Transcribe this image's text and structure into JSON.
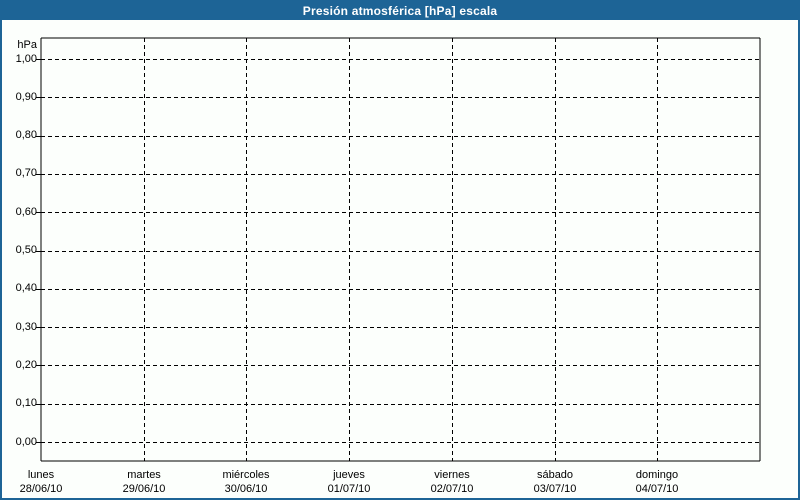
{
  "window": {
    "title": "Presión atmosférica [hPa] escala",
    "colors": {
      "title_bar": "#1d6496",
      "border": "#1d6496",
      "background": "#fcfffc",
      "grid": "#000000",
      "text": "#000000",
      "title_text": "#ffffff"
    }
  },
  "chart_data": {
    "type": "line",
    "title": "Presión atmosférica [hPa] escala",
    "ylabel": "hPa",
    "xlabel": "",
    "ylim": [
      0.0,
      1.0
    ],
    "y_tick_step": 0.1,
    "y_tick_labels": [
      "1,00",
      "0,90",
      "0,80",
      "0,70",
      "0,60",
      "0,50",
      "0,40",
      "0,30",
      "0,20",
      "0,10",
      "0,00"
    ],
    "x_tick_labels": [
      {
        "day": "lunes",
        "date": "28/06/10"
      },
      {
        "day": "martes",
        "date": "29/06/10"
      },
      {
        "day": "miércoles",
        "date": "30/06/10"
      },
      {
        "day": "jueves",
        "date": "01/07/10"
      },
      {
        "day": "viernes",
        "date": "02/07/10"
      },
      {
        "day": "sábado",
        "date": "03/07/10"
      },
      {
        "day": "domingo",
        "date": "04/07/10"
      }
    ],
    "series": [],
    "grid": "dashed",
    "legend": "none"
  }
}
